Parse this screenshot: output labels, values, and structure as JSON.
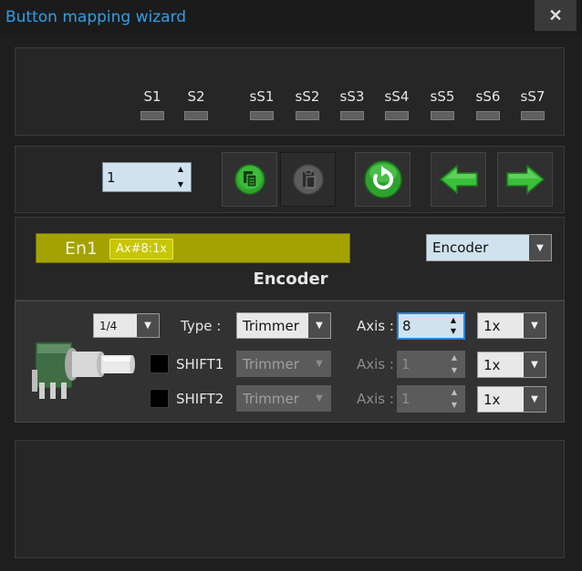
{
  "window": {
    "title": "Button mapping wizard",
    "close_glyph": "✕"
  },
  "leds": {
    "items": [
      "S1",
      "S2",
      "sS1",
      "sS2",
      "sS3",
      "sS4",
      "sS5",
      "sS6",
      "sS7"
    ]
  },
  "toolbar": {
    "index_value": "1",
    "icons": [
      "copy-icon",
      "paste-icon",
      "refresh-icon",
      "arrow-left-icon",
      "arrow-right-icon"
    ]
  },
  "mapping": {
    "name": "En1",
    "badge": "Ax#8:1x",
    "mode_select": "Encoder",
    "heading": "Encoder"
  },
  "params": {
    "step_select": "1/4",
    "type_label": "Type :",
    "type_value": "Trimmer",
    "axis_label": "Axis :",
    "axis_value": "8",
    "mult_value": "1x",
    "shift1": {
      "label": "SHIFT1",
      "type_value": "Trimmer",
      "axis_label": "Axis :",
      "axis_value": "1",
      "mult_value": "1x"
    },
    "shift2": {
      "label": "SHIFT2",
      "type_value": "Trimmer",
      "axis_label": "Axis :",
      "axis_value": "1",
      "mult_value": "1x"
    }
  },
  "colors": {
    "title": "#2f9fe8",
    "badge_bar": "#a3a200",
    "button_green": "#39c13a"
  }
}
